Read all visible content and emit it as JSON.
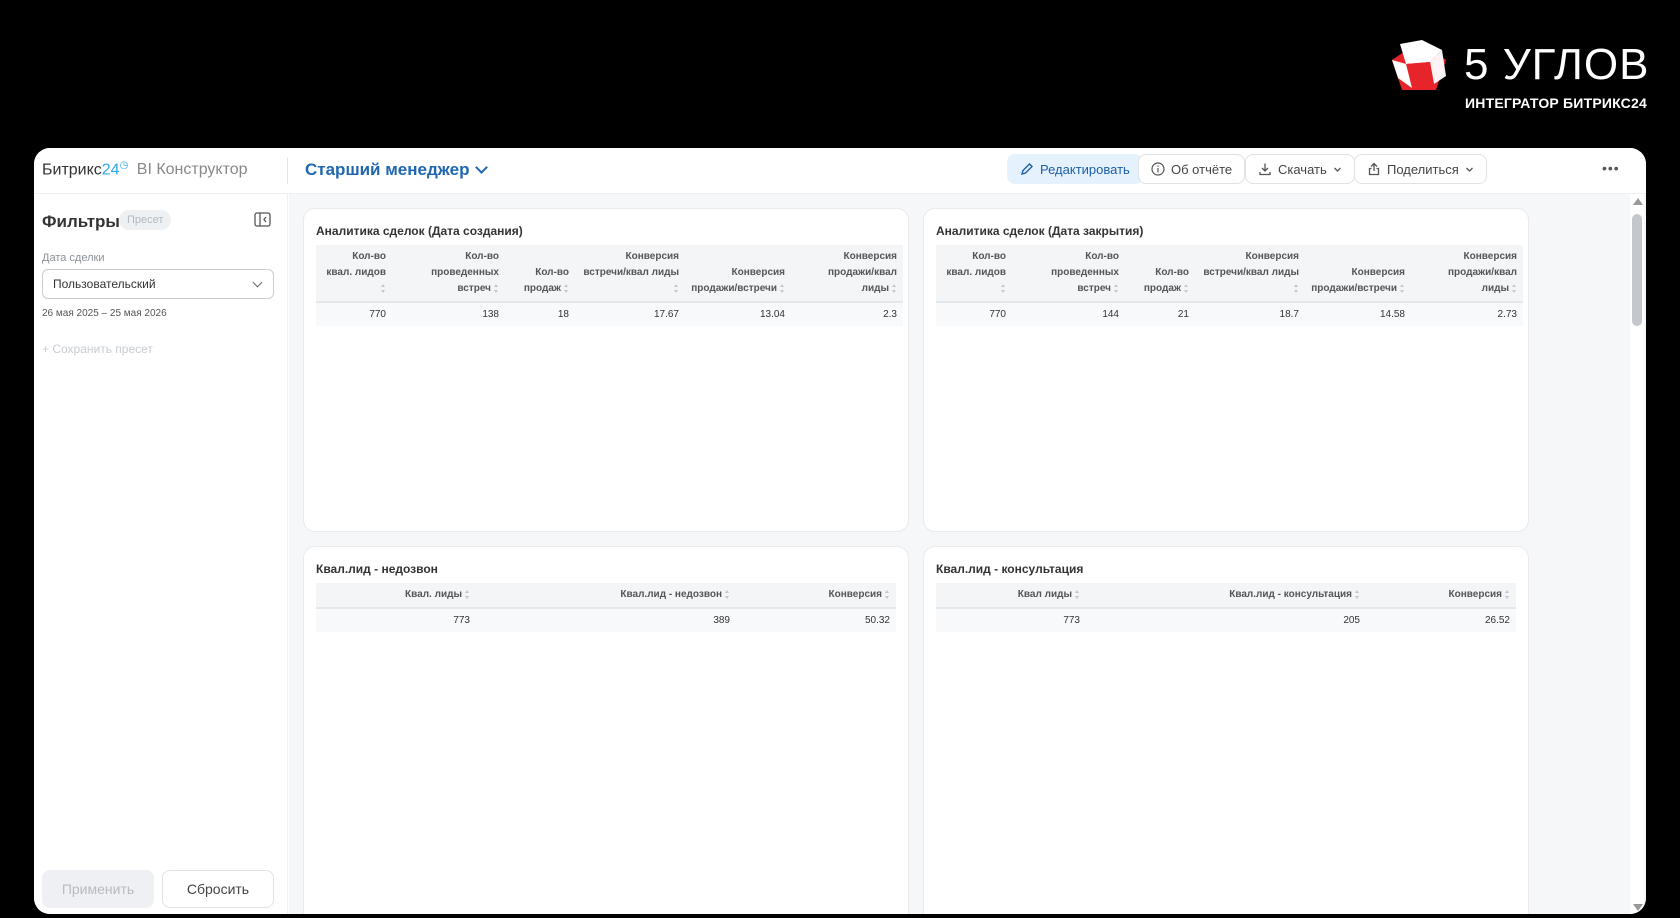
{
  "brand": {
    "name": "5 УГЛОВ",
    "subtitle": "ИНТЕГРАТОР БИТРИКС24",
    "accent": "#e8242b"
  },
  "app": {
    "name_part1": "Битрикс",
    "name_part2": "24",
    "module": "BI Конструктор"
  },
  "report": {
    "title": "Старший менеджер"
  },
  "toolbar": {
    "edit": "Редактировать",
    "about": "Об отчёте",
    "download": "Скачать",
    "share": "Поделиться",
    "more": "•••"
  },
  "sidebar": {
    "title": "Фильтры",
    "preset_badge": "Пресет",
    "field_label": "Дата сделки",
    "select_value": "Пользовательский",
    "date_range": "26 мая 2025 – 25 мая 2026",
    "save_preset": "+ Сохранить пресет",
    "apply": "Применить",
    "reset": "Сбросить"
  },
  "cards": [
    {
      "title": "Аналитика сделок (Дата создания)",
      "headers": [
        [
          "Кол-во",
          "квал. лидов"
        ],
        [
          "Кол-во",
          "проведенных",
          "встреч"
        ],
        [
          "Кол-во",
          "продаж"
        ],
        [
          "Конверсия",
          "встречи/квал лиды"
        ],
        [
          "Конверсия",
          "продажи/встречи"
        ],
        [
          "Конверсия",
          "продажи/квал",
          "лиды"
        ]
      ],
      "rows": [
        [
          "770",
          "138",
          "18",
          "17.67",
          "13.04",
          "2.3"
        ]
      ]
    },
    {
      "title": "Аналитика сделок (Дата закрытия)",
      "headers": [
        [
          "Кол-во",
          "квал. лидов"
        ],
        [
          "Кол-во",
          "проведенных",
          "встреч"
        ],
        [
          "Кол-во",
          "продаж"
        ],
        [
          "Конверсия",
          "встречи/квал лиды"
        ],
        [
          "Конверсия",
          "продажи/встречи"
        ],
        [
          "Конверсия",
          "продажи/квал",
          "лиды"
        ]
      ],
      "rows": [
        [
          "770",
          "144",
          "21",
          "18.7",
          "14.58",
          "2.73"
        ]
      ]
    },
    {
      "title": "Квал.лид - недозвон",
      "headers": [
        [
          "Квал. лиды"
        ],
        [
          "Квал.лид - недозвон"
        ],
        [
          "Конверсия"
        ]
      ],
      "rows": [
        [
          "773",
          "389",
          "50.32"
        ]
      ]
    },
    {
      "title": "Квал.лид - консультация",
      "headers": [
        [
          "Квал лиды"
        ],
        [
          "Квал.лид - консультация"
        ],
        [
          "Конверсия"
        ]
      ],
      "rows": [
        [
          "773",
          "205",
          "26.52"
        ]
      ]
    }
  ]
}
